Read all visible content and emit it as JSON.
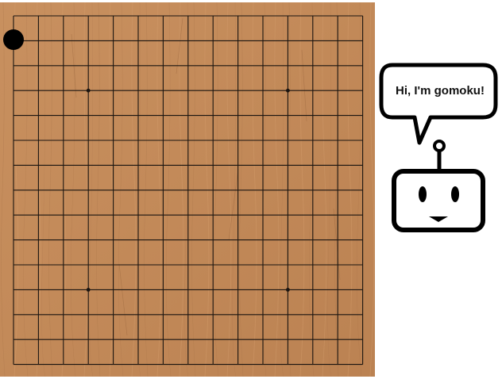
{
  "game": {
    "name": "gomoku",
    "board_size": 15,
    "star_points": [
      [
        3,
        3
      ],
      [
        11,
        3
      ],
      [
        3,
        11
      ],
      [
        11,
        11
      ]
    ],
    "stones": [
      {
        "col": 0,
        "row": 0,
        "color": "black"
      }
    ]
  },
  "bot": {
    "speech": "Hi, I'm gomoku!"
  },
  "colors": {
    "board_wood": "#c48a5a",
    "grid_line": "#1a1410",
    "stone_black": "#000000",
    "bot_outline": "#000000",
    "bot_fill": "#ffffff"
  }
}
